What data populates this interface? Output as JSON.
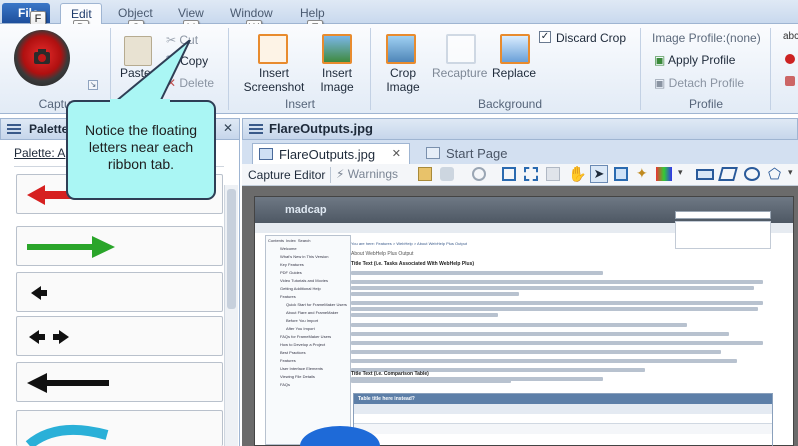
{
  "ribbon": {
    "tabs": [
      "File",
      "Edit",
      "Object",
      "View",
      "Window",
      "Help"
    ],
    "keytips": [
      "F",
      "D",
      "O",
      "V",
      "W",
      "E"
    ],
    "capture_group": {
      "label": "Capture"
    },
    "clipboard": {
      "paste": "Paste",
      "cut": "Cut",
      "copy": "Copy",
      "delete": "Delete"
    },
    "insert_group": {
      "insert_screenshot": "Insert\nScreenshot",
      "insert_image": "Insert\nImage",
      "label": "Insert"
    },
    "background_group": {
      "crop_image": "Crop\nImage",
      "recapture": "Recapture",
      "replace": "Replace",
      "discard_crop": "Discard Crop",
      "label": "Background"
    },
    "profile_group": {
      "image_profile": "Image Profile:(none)",
      "apply_profile": "Apply Profile",
      "detach_profile": "Detach Profile",
      "label": "Profile"
    },
    "accent": "#e88b2e"
  },
  "callout": {
    "text": "Notice the floating letters near each ribbon tab."
  },
  "palette": {
    "title": "Palette",
    "label": "Palette: A"
  },
  "editor": {
    "window_title": "FlareOutputs.jpg",
    "tabs": [
      "FlareOutputs.jpg",
      "Start Page"
    ],
    "toolbar_label": "Capture Editor",
    "warnings": "Warnings"
  },
  "screenshot_content": {
    "brand": "madcap",
    "breadcrumb": "You are here: Features > WebHelp > About WebHelp Plus Output",
    "heading": "About WebHelp Plus Output",
    "title1": "Title Text (i.e. Tasks Associated With WebHelp Plus)",
    "title2": "Title Text (i.e. Comparison Table)",
    "table_title": "Table title here instead?",
    "toc_tabs": [
      "Contents",
      "Index",
      "Search"
    ],
    "toc_items": [
      "Welcome",
      "What's New in This Version",
      "Key Features",
      "PDF Guides",
      "Video Tutorials and Movies",
      "Getting Additional Help",
      "Features",
      "Quick Start for FrameMaker Users",
      "About Flare and FrameMaker",
      "Before You Import",
      "After You Import",
      "FAQs for FrameMaker Users",
      "How to Develop a Project",
      "Best Practices",
      "Features",
      "User Interface Elements",
      "Viewing File Details",
      "FAQs"
    ]
  }
}
